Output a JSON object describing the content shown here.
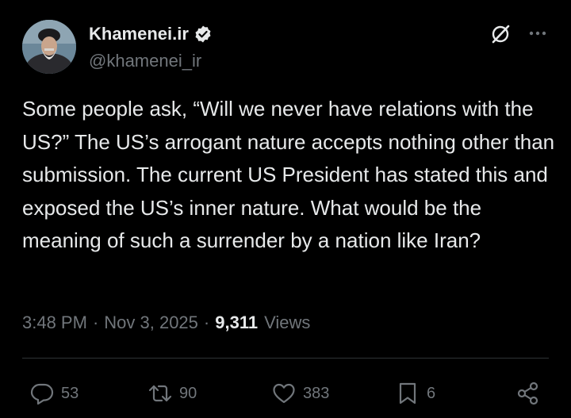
{
  "author": {
    "display_name": "Khamenei.ir",
    "handle": "@khamenei_ir",
    "verified": true
  },
  "tweet": {
    "text": "Some people ask, “Will we never have relations with the US?” The US’s arrogant nature accepts nothing other than submission. The current US President has stated this and exposed the US’s inner nature. What would be the meaning of such a surrender by a nation like Iran?",
    "time": "3:48 PM",
    "separator": "·",
    "date": "Nov 3, 2025",
    "views_count": "9,311",
    "views_label": "Views"
  },
  "actions": {
    "replies": "53",
    "retweets": "90",
    "likes": "383",
    "bookmarks": "6"
  },
  "colors": {
    "background": "#000000",
    "text": "#e7e9ea",
    "muted": "#71767b",
    "verified_badge": "#e7e9ea"
  },
  "icons": [
    "verified-badge-icon",
    "grok-icon",
    "more-icon",
    "reply-icon",
    "retweet-icon",
    "like-icon",
    "bookmark-icon",
    "share-icon"
  ]
}
